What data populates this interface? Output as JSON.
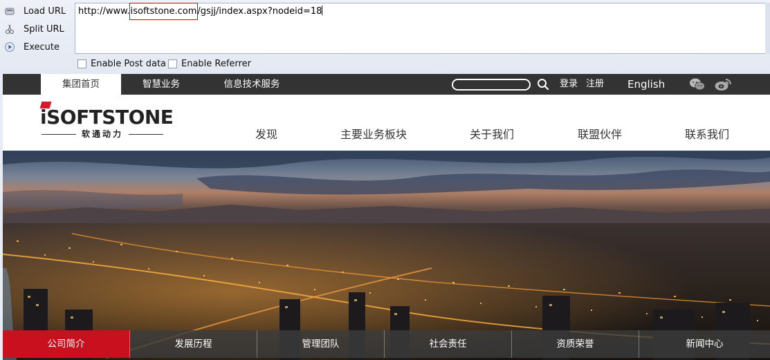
{
  "hackbar": {
    "load_url": "Load URL",
    "split_url": "Split URL",
    "execute": "Execute",
    "url_prefix": "http://www.",
    "url_highlight": "isoftstone.com",
    "url_suffix": "/gsjj/index.aspx?nodeid=18",
    "enable_post": "Enable Post data",
    "enable_referrer": "Enable Referrer"
  },
  "topbar": {
    "tabs": [
      "集团首页",
      "智慧业务",
      "信息技术服务"
    ],
    "login": "登录",
    "register": "注册",
    "english": "English"
  },
  "header": {
    "logo_main": "SOFTSTONE",
    "logo_sub": "软通动力",
    "nav": [
      "发现",
      "主要业务板块",
      "关于我们",
      "联盟伙伴",
      "联系我们"
    ]
  },
  "subnav": {
    "items": [
      "公司简介",
      "发展历程",
      "管理团队",
      "社会责任",
      "资质荣誉",
      "新闻中心"
    ],
    "active_index": 0
  },
  "watermark": "",
  "colors": {
    "accent_red": "#c8101e",
    "topbar_bg": "#333333",
    "url_highlight_border": "#dd0000"
  }
}
